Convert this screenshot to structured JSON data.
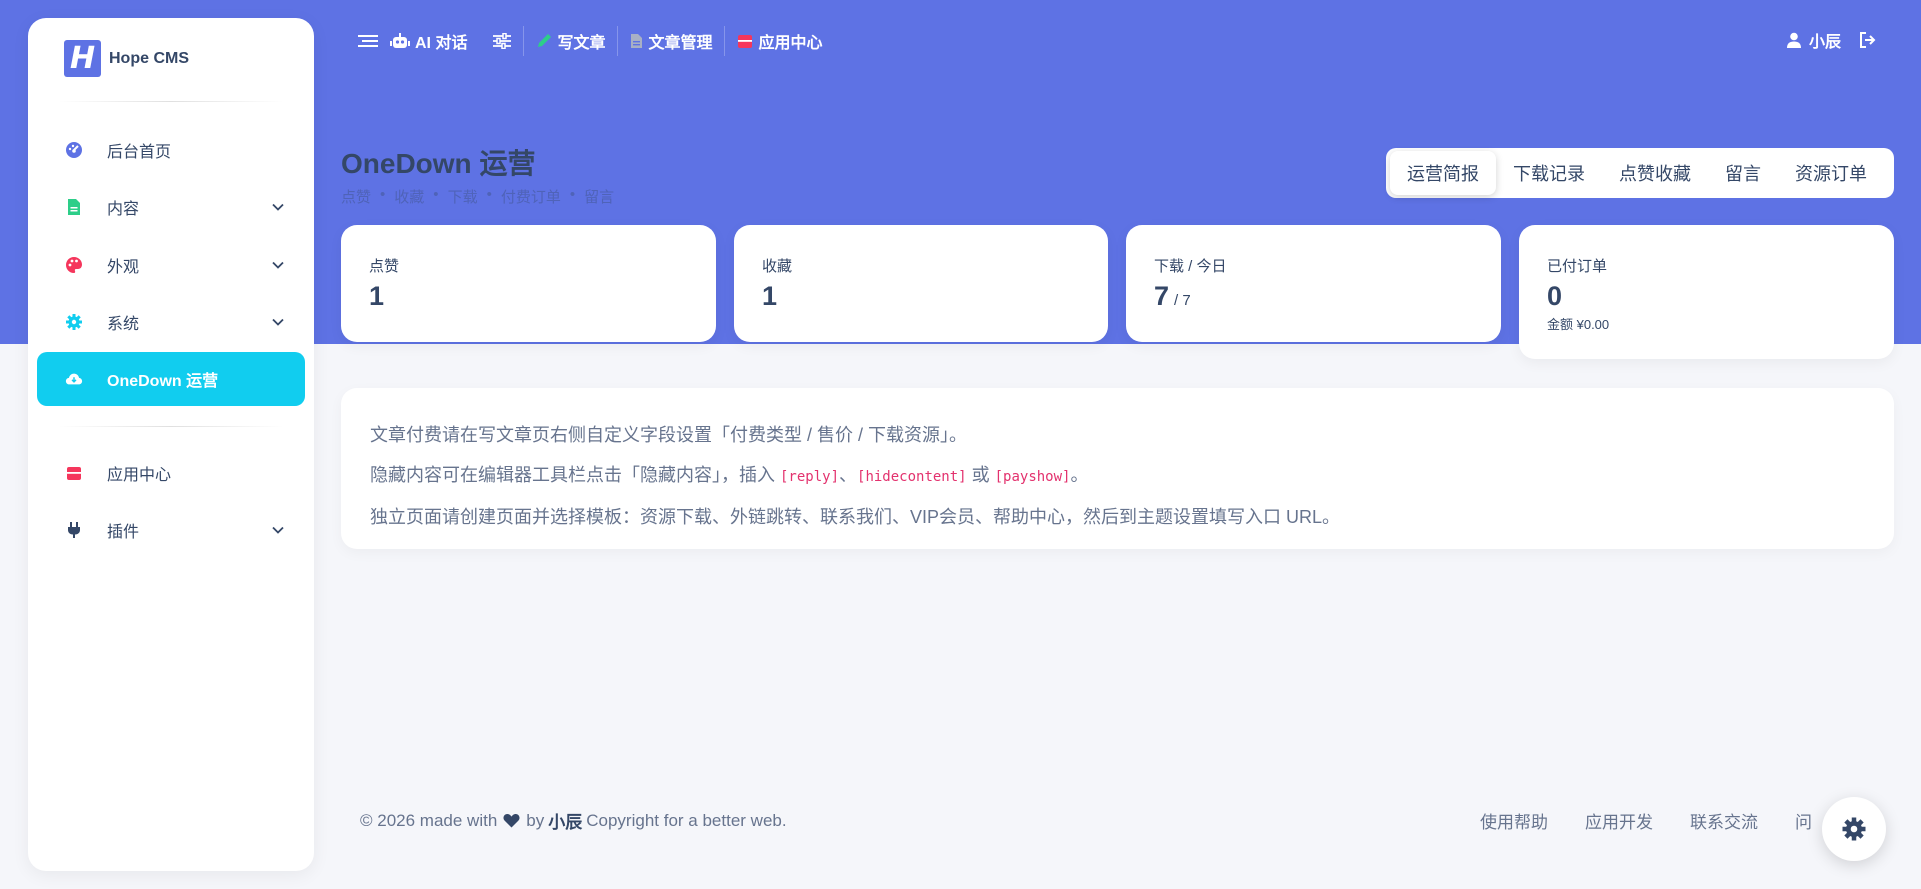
{
  "brand": {
    "logo_letter": "H",
    "name": "Hope CMS"
  },
  "sidebar": {
    "items": [
      {
        "label": "后台首页",
        "icon": "dashboard-icon",
        "color": "#5e72e4"
      },
      {
        "label": "内容",
        "icon": "file-icon",
        "color": "#2dce89"
      },
      {
        "label": "外观",
        "icon": "palette-icon",
        "color": "#f5365c"
      },
      {
        "label": "系统",
        "icon": "gear-icon",
        "color": "#11cdef"
      },
      {
        "label": "OneDown 运营",
        "icon": "cloud-icon",
        "color": "#ffffff"
      },
      {
        "label": "应用中心",
        "icon": "store-icon",
        "color": "#f5365c"
      },
      {
        "label": "插件",
        "icon": "plug-icon",
        "color": "#344767"
      }
    ]
  },
  "topnav": {
    "ai_chat": "AI 对话",
    "write": "写文章",
    "manage": "文章管理",
    "apps": "应用中心",
    "user": "小辰"
  },
  "page": {
    "title": "OneDown 运营",
    "breadcrumb": [
      "点赞",
      "收藏",
      "下载",
      "付费订单",
      "留言"
    ]
  },
  "tabs": [
    "运营简报",
    "下载记录",
    "点赞收藏",
    "留言",
    "资源订单"
  ],
  "stats": {
    "likes": {
      "label": "点赞",
      "value": "1"
    },
    "favorites": {
      "label": "收藏",
      "value": "1"
    },
    "downloads": {
      "label": "下载 / 今日",
      "value": "7",
      "sub": "/ 7"
    },
    "orders": {
      "label": "已付订单",
      "value": "0",
      "note": "金额 ¥0.00"
    }
  },
  "info": {
    "line1": "文章付费请在写文章页右侧自定义字段设置「付费类型 / 售价 / 下载资源」。",
    "line2_a": "隐藏内容可在编辑器工具栏点击「隐藏内容」，插入 ",
    "code1": "[reply]",
    "sep1": "、",
    "code2": "[hidecontent]",
    "sep2": " 或 ",
    "code3": "[payshow]",
    "line2_end": "。",
    "line3": "独立页面请创建页面并选择模板：资源下载、外链跳转、联系我们、VIP会员、帮助中心，然后到主题设置填写入口 URL。"
  },
  "footer": {
    "copyright": "© 2026 made with",
    "by": "by",
    "author": "小辰",
    "tail": "Copyright for a better web.",
    "links": [
      "使用帮助",
      "应用开发",
      "联系交流",
      "问"
    ]
  }
}
